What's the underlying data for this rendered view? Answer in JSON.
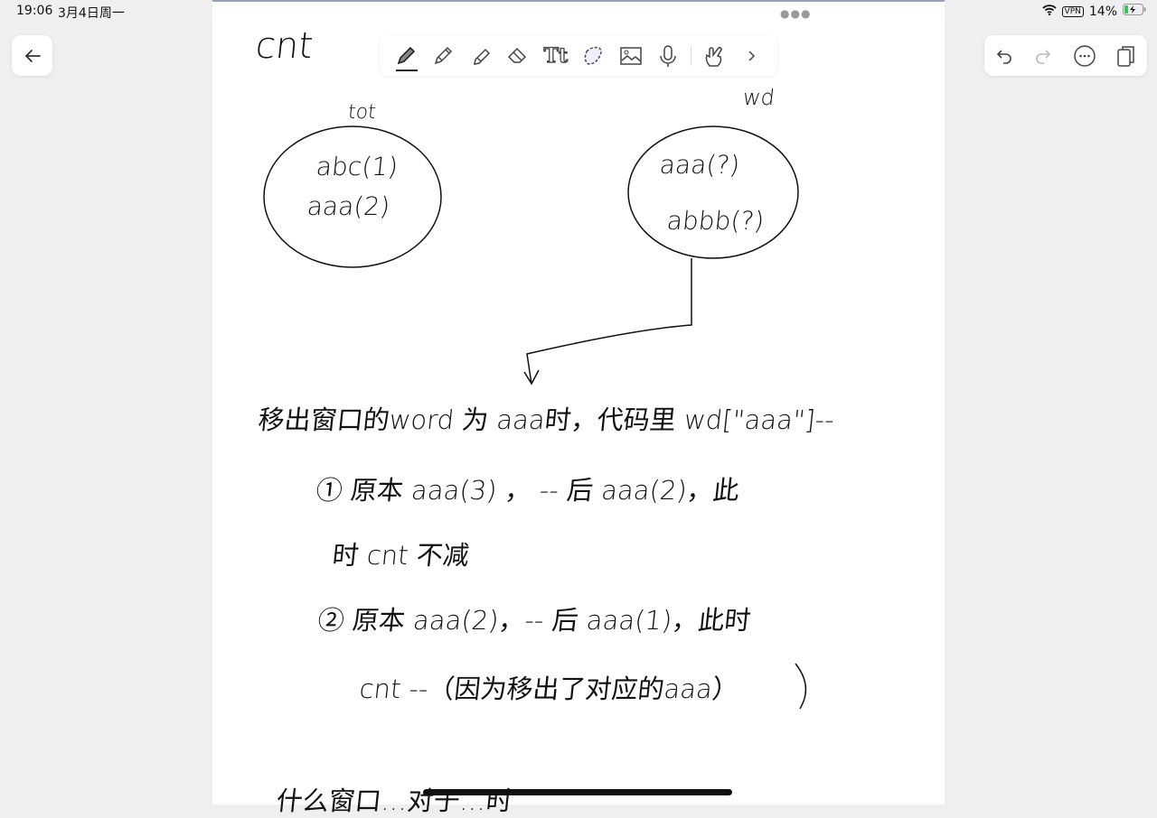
{
  "status_bar": {
    "time": "19:06",
    "date": "3月4日周一",
    "vpn": "VPN",
    "battery": "14%"
  },
  "toolbar": {
    "tools": [
      {
        "icon": "pen-icon",
        "active": true
      },
      {
        "icon": "pencil-icon"
      },
      {
        "icon": "highlighter-icon"
      },
      {
        "icon": "eraser-icon"
      },
      {
        "icon": "text-tool-icon",
        "label": "Tt"
      },
      {
        "icon": "lasso-icon"
      },
      {
        "icon": "image-icon"
      },
      {
        "icon": "microphone-icon"
      },
      {
        "icon": "hand-touch-icon"
      },
      {
        "icon": "chevron-right-icon"
      }
    ]
  },
  "nav": {
    "back_icon": "arrow-left-icon",
    "undo_icon": "undo-icon",
    "redo_icon": "redo-icon",
    "more_icon": "ellipsis-circle-icon",
    "pages_icon": "pages-icon"
  },
  "notes": {
    "title": "cnt",
    "left_label": "tot",
    "left_items": [
      "abc(1)",
      "aaa(2)"
    ],
    "right_label": "wd",
    "right_items": [
      "aaa(?)",
      "abbb(?)"
    ],
    "line1": "移出窗口的word 为 aaa时，代码里 wd[\"aaa\"]--",
    "case1a": "① 原本  aaa(3) ， -- 后  aaa(2)，此",
    "case1b": "时 cnt 不减",
    "case2a": "② 原本  aaa(2)，-- 后 aaa(1)，此时",
    "case2b": "cnt --（因为移出了对应的aaa）",
    "line_bottom": "什么窗口…对于…时"
  }
}
